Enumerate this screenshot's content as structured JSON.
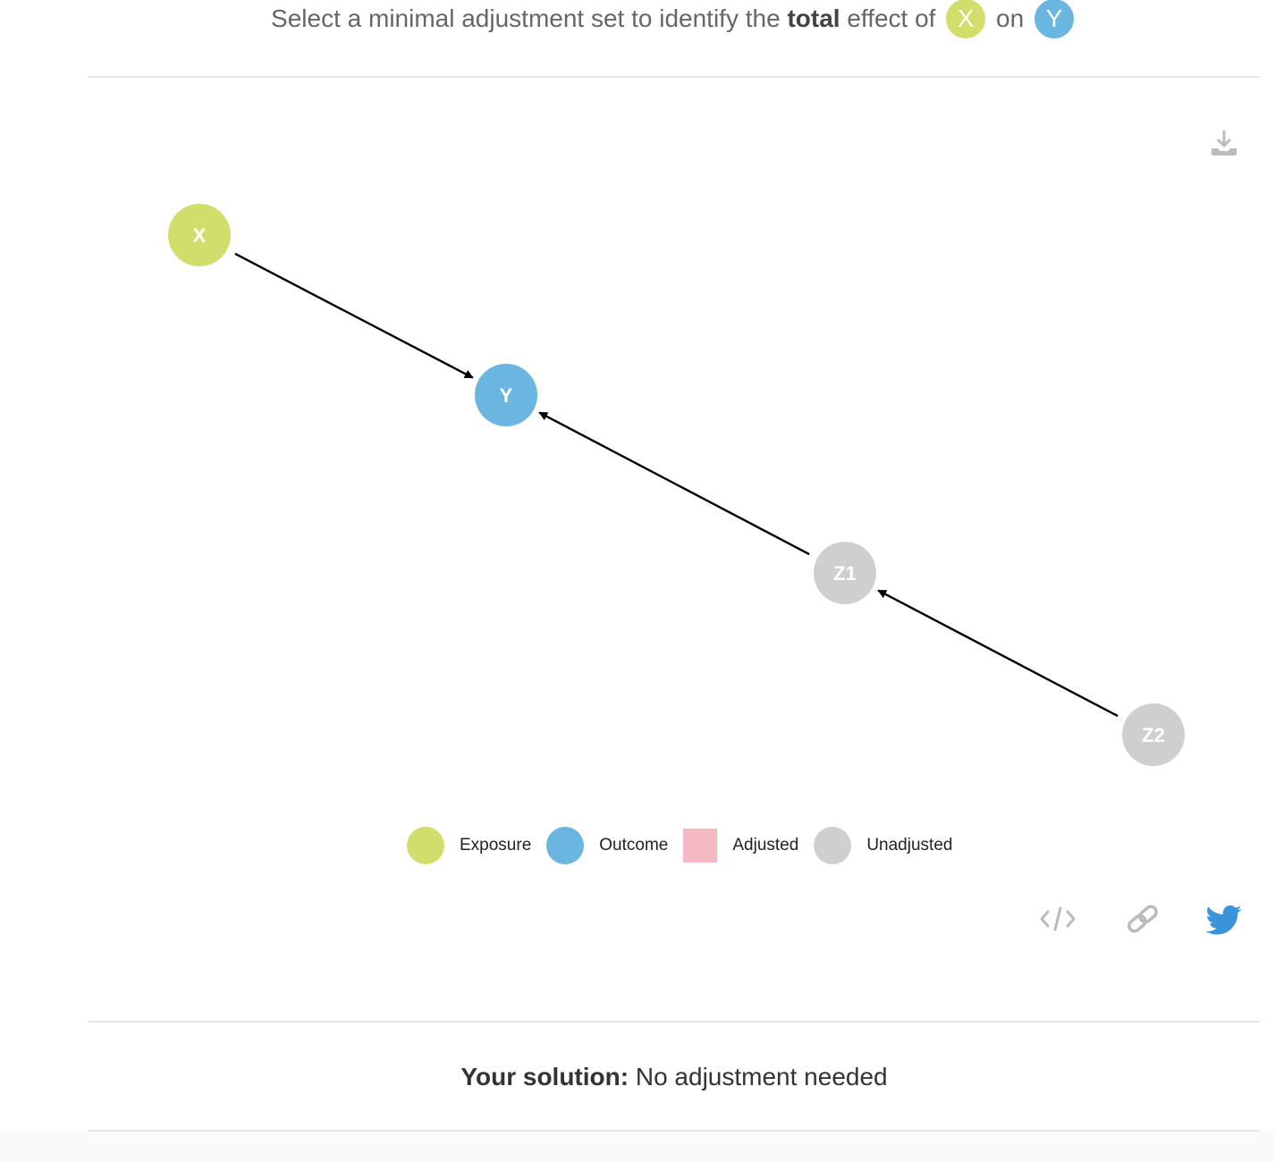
{
  "prompt": {
    "prefix": "Select a minimal adjustment set to identify the",
    "emphasis": "total",
    "middle": "effect of",
    "exposure_chip": "X",
    "connector": "on",
    "outcome_chip": "Y"
  },
  "dag": {
    "nodes": [
      {
        "id": "X",
        "label": "X",
        "role": "exposure"
      },
      {
        "id": "Y",
        "label": "Y",
        "role": "outcome"
      },
      {
        "id": "Z1",
        "label": "Z1",
        "role": "unadjusted"
      },
      {
        "id": "Z2",
        "label": "Z2",
        "role": "unadjusted"
      }
    ],
    "edges": [
      {
        "from": "X",
        "to": "Y"
      },
      {
        "from": "Z1",
        "to": "Y"
      },
      {
        "from": "Z2",
        "to": "Z1"
      }
    ]
  },
  "legend": {
    "exposure": "Exposure",
    "outcome": "Outcome",
    "adjusted": "Adjusted",
    "unadjusted": "Unadjusted"
  },
  "colors": {
    "exposure": "#d2de6b",
    "outcome": "#6ab6e0",
    "adjusted": "#f4b9c3",
    "unadjusted": "#cfcfcf",
    "edge": "#000000",
    "icon_gray": "#bbbbbb",
    "twitter": "#3b94d9"
  },
  "icons": {
    "download": "download-icon",
    "embed": "code-icon",
    "link": "link-icon",
    "share": "twitter-icon"
  },
  "solution": {
    "label": "Your solution:",
    "value": "No adjustment needed"
  }
}
